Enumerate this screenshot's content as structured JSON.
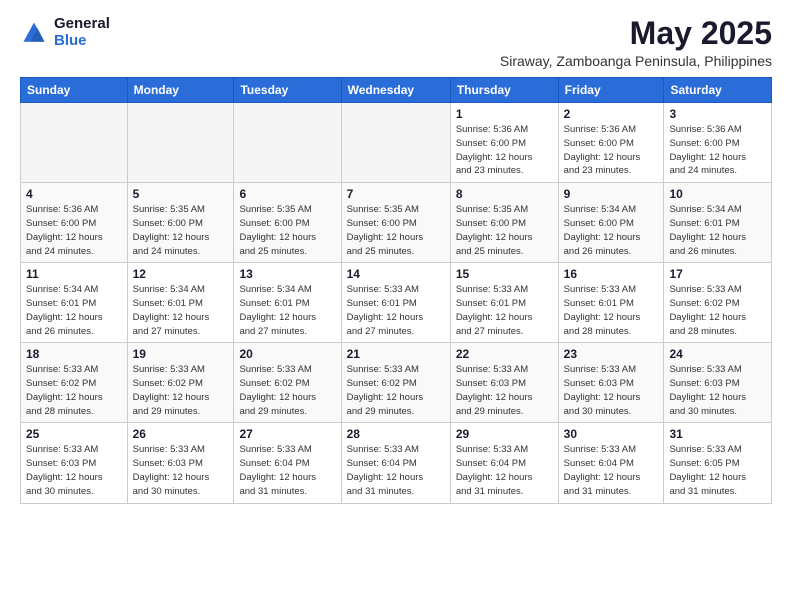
{
  "logo": {
    "general": "General",
    "blue": "Blue"
  },
  "title": "May 2025",
  "subtitle": "Siraway, Zamboanga Peninsula, Philippines",
  "days_header": [
    "Sunday",
    "Monday",
    "Tuesday",
    "Wednesday",
    "Thursday",
    "Friday",
    "Saturday"
  ],
  "weeks": [
    [
      {
        "day": "",
        "info": ""
      },
      {
        "day": "",
        "info": ""
      },
      {
        "day": "",
        "info": ""
      },
      {
        "day": "",
        "info": ""
      },
      {
        "day": "1",
        "info": "Sunrise: 5:36 AM\nSunset: 6:00 PM\nDaylight: 12 hours\nand 23 minutes."
      },
      {
        "day": "2",
        "info": "Sunrise: 5:36 AM\nSunset: 6:00 PM\nDaylight: 12 hours\nand 23 minutes."
      },
      {
        "day": "3",
        "info": "Sunrise: 5:36 AM\nSunset: 6:00 PM\nDaylight: 12 hours\nand 24 minutes."
      }
    ],
    [
      {
        "day": "4",
        "info": "Sunrise: 5:36 AM\nSunset: 6:00 PM\nDaylight: 12 hours\nand 24 minutes."
      },
      {
        "day": "5",
        "info": "Sunrise: 5:35 AM\nSunset: 6:00 PM\nDaylight: 12 hours\nand 24 minutes."
      },
      {
        "day": "6",
        "info": "Sunrise: 5:35 AM\nSunset: 6:00 PM\nDaylight: 12 hours\nand 25 minutes."
      },
      {
        "day": "7",
        "info": "Sunrise: 5:35 AM\nSunset: 6:00 PM\nDaylight: 12 hours\nand 25 minutes."
      },
      {
        "day": "8",
        "info": "Sunrise: 5:35 AM\nSunset: 6:00 PM\nDaylight: 12 hours\nand 25 minutes."
      },
      {
        "day": "9",
        "info": "Sunrise: 5:34 AM\nSunset: 6:00 PM\nDaylight: 12 hours\nand 26 minutes."
      },
      {
        "day": "10",
        "info": "Sunrise: 5:34 AM\nSunset: 6:01 PM\nDaylight: 12 hours\nand 26 minutes."
      }
    ],
    [
      {
        "day": "11",
        "info": "Sunrise: 5:34 AM\nSunset: 6:01 PM\nDaylight: 12 hours\nand 26 minutes."
      },
      {
        "day": "12",
        "info": "Sunrise: 5:34 AM\nSunset: 6:01 PM\nDaylight: 12 hours\nand 27 minutes."
      },
      {
        "day": "13",
        "info": "Sunrise: 5:34 AM\nSunset: 6:01 PM\nDaylight: 12 hours\nand 27 minutes."
      },
      {
        "day": "14",
        "info": "Sunrise: 5:33 AM\nSunset: 6:01 PM\nDaylight: 12 hours\nand 27 minutes."
      },
      {
        "day": "15",
        "info": "Sunrise: 5:33 AM\nSunset: 6:01 PM\nDaylight: 12 hours\nand 27 minutes."
      },
      {
        "day": "16",
        "info": "Sunrise: 5:33 AM\nSunset: 6:01 PM\nDaylight: 12 hours\nand 28 minutes."
      },
      {
        "day": "17",
        "info": "Sunrise: 5:33 AM\nSunset: 6:02 PM\nDaylight: 12 hours\nand 28 minutes."
      }
    ],
    [
      {
        "day": "18",
        "info": "Sunrise: 5:33 AM\nSunset: 6:02 PM\nDaylight: 12 hours\nand 28 minutes."
      },
      {
        "day": "19",
        "info": "Sunrise: 5:33 AM\nSunset: 6:02 PM\nDaylight: 12 hours\nand 29 minutes."
      },
      {
        "day": "20",
        "info": "Sunrise: 5:33 AM\nSunset: 6:02 PM\nDaylight: 12 hours\nand 29 minutes."
      },
      {
        "day": "21",
        "info": "Sunrise: 5:33 AM\nSunset: 6:02 PM\nDaylight: 12 hours\nand 29 minutes."
      },
      {
        "day": "22",
        "info": "Sunrise: 5:33 AM\nSunset: 6:03 PM\nDaylight: 12 hours\nand 29 minutes."
      },
      {
        "day": "23",
        "info": "Sunrise: 5:33 AM\nSunset: 6:03 PM\nDaylight: 12 hours\nand 30 minutes."
      },
      {
        "day": "24",
        "info": "Sunrise: 5:33 AM\nSunset: 6:03 PM\nDaylight: 12 hours\nand 30 minutes."
      }
    ],
    [
      {
        "day": "25",
        "info": "Sunrise: 5:33 AM\nSunset: 6:03 PM\nDaylight: 12 hours\nand 30 minutes."
      },
      {
        "day": "26",
        "info": "Sunrise: 5:33 AM\nSunset: 6:03 PM\nDaylight: 12 hours\nand 30 minutes."
      },
      {
        "day": "27",
        "info": "Sunrise: 5:33 AM\nSunset: 6:04 PM\nDaylight: 12 hours\nand 31 minutes."
      },
      {
        "day": "28",
        "info": "Sunrise: 5:33 AM\nSunset: 6:04 PM\nDaylight: 12 hours\nand 31 minutes."
      },
      {
        "day": "29",
        "info": "Sunrise: 5:33 AM\nSunset: 6:04 PM\nDaylight: 12 hours\nand 31 minutes."
      },
      {
        "day": "30",
        "info": "Sunrise: 5:33 AM\nSunset: 6:04 PM\nDaylight: 12 hours\nand 31 minutes."
      },
      {
        "day": "31",
        "info": "Sunrise: 5:33 AM\nSunset: 6:05 PM\nDaylight: 12 hours\nand 31 minutes."
      }
    ]
  ]
}
